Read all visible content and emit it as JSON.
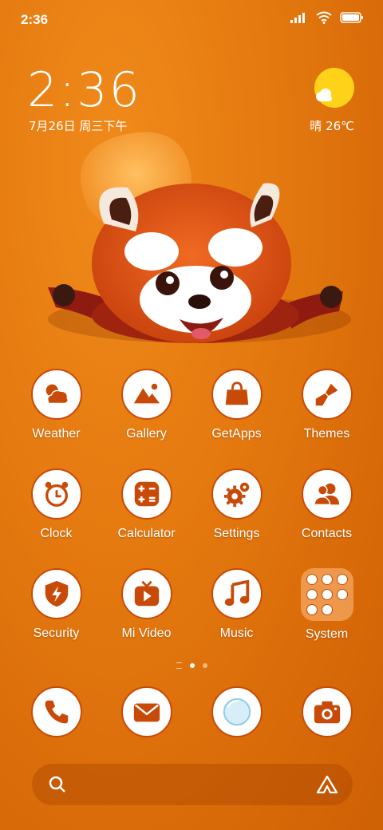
{
  "status": {
    "time": "2:36"
  },
  "clock_widget": {
    "time": "2:36",
    "date": "7月26日 周三下午"
  },
  "weather_widget": {
    "text": "晴 26℃"
  },
  "apps": [
    {
      "label": "Weather",
      "icon": "cloud-sun-icon"
    },
    {
      "label": "Gallery",
      "icon": "mountain-icon"
    },
    {
      "label": "GetApps",
      "icon": "shopping-bag-icon"
    },
    {
      "label": "Themes",
      "icon": "paintbrush-icon"
    },
    {
      "label": "Clock",
      "icon": "alarm-clock-icon"
    },
    {
      "label": "Calculator",
      "icon": "calculator-icon"
    },
    {
      "label": "Settings",
      "icon": "gear-icon"
    },
    {
      "label": "Contacts",
      "icon": "people-icon"
    },
    {
      "label": "Security",
      "icon": "shield-bolt-icon"
    },
    {
      "label": "Mi Video",
      "icon": "tv-play-icon"
    },
    {
      "label": "Music",
      "icon": "music-note-icon"
    },
    {
      "label": "System",
      "icon": "folder-icon"
    }
  ],
  "dock": [
    {
      "icon": "phone-icon"
    },
    {
      "icon": "envelope-icon"
    },
    {
      "icon": "browser-globe-icon"
    },
    {
      "icon": "camera-icon"
    }
  ],
  "pager": {
    "pages": 2,
    "current": 1
  },
  "colors": {
    "accent": "#c84a08",
    "background": "#e57a10"
  }
}
